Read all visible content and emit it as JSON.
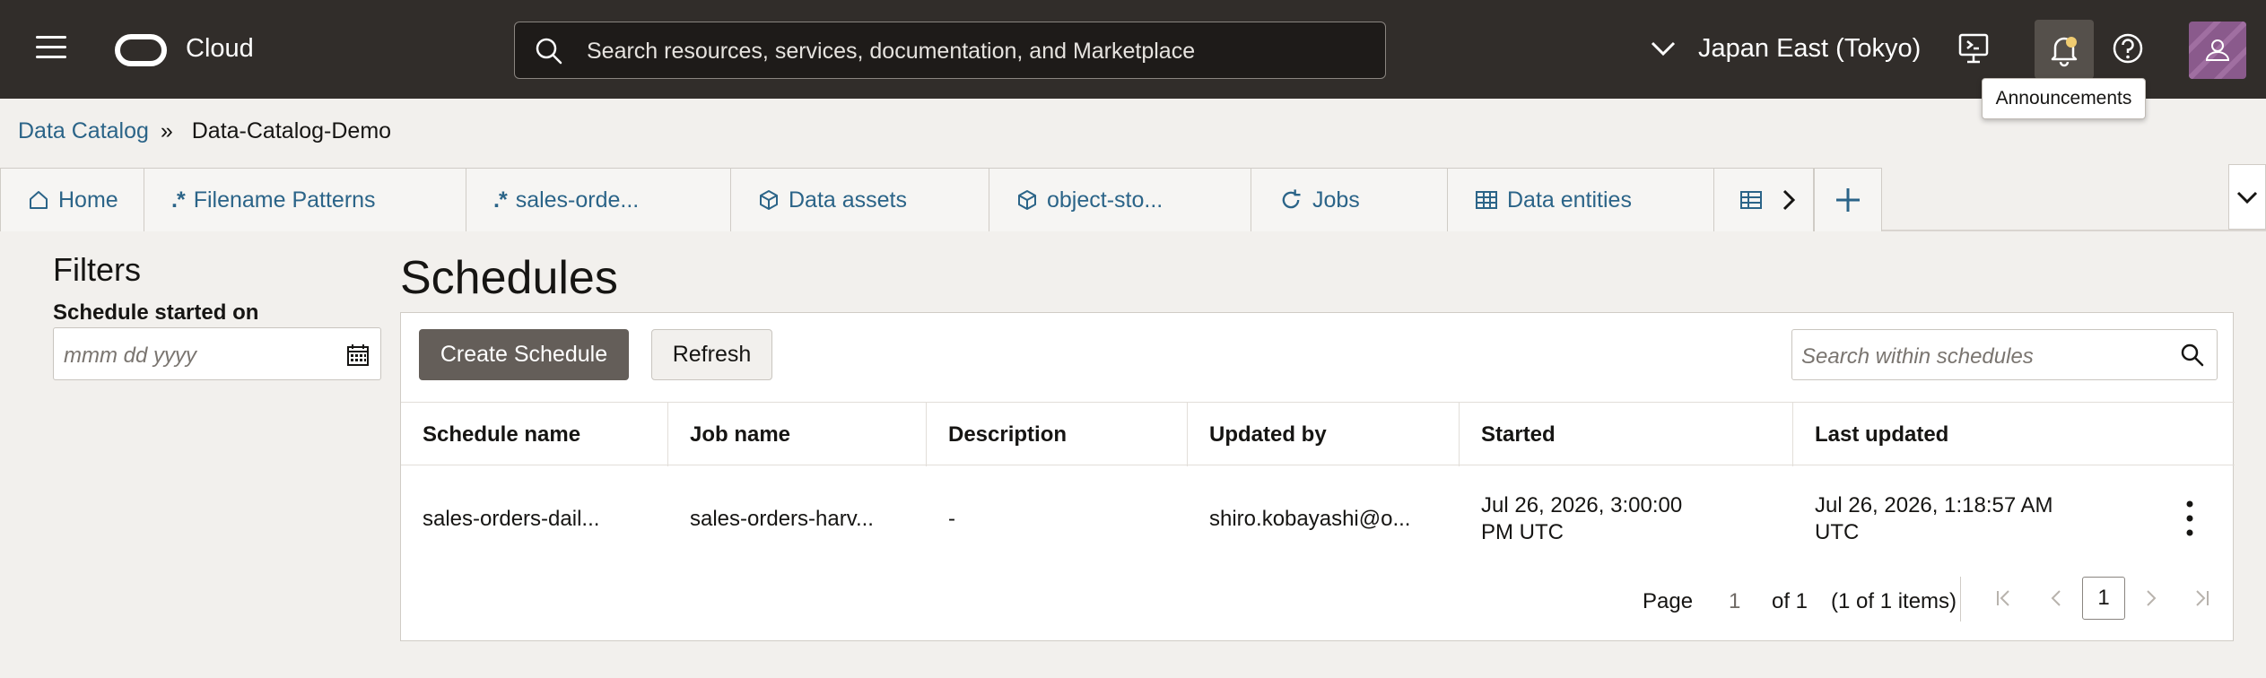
{
  "header": {
    "logo_text": "Cloud",
    "search_placeholder": "Search resources, services, documentation, and Marketplace",
    "region": "Japan East (Tokyo)",
    "tooltip": "Announcements"
  },
  "breadcrumb": {
    "root": "Data Catalog",
    "separator": "»",
    "current": "Data-Catalog-Demo"
  },
  "tabs": [
    {
      "label": "Home",
      "icon": "home-icon"
    },
    {
      "label": "Filename Patterns",
      "icon": "regex-icon"
    },
    {
      "label": "sales-orde...",
      "icon": "regex-icon"
    },
    {
      "label": "Data assets",
      "icon": "cube-icon"
    },
    {
      "label": "object-sto...",
      "icon": "cube-icon"
    },
    {
      "label": "Jobs",
      "icon": "refresh-icon"
    },
    {
      "label": "Data entities",
      "icon": "table-icon"
    }
  ],
  "filters": {
    "title": "Filters",
    "schedule_started_label": "Schedule started on",
    "date_placeholder": "mmm dd yyyy"
  },
  "main": {
    "title": "Schedules",
    "create_button": "Create Schedule",
    "refresh_button": "Refresh",
    "search_placeholder": "Search within schedules"
  },
  "table": {
    "columns": [
      "Schedule name",
      "Job name",
      "Description",
      "Updated by",
      "Started",
      "Last updated"
    ],
    "rows": [
      {
        "schedule_name": "sales-orders-dail...",
        "job_name": "sales-orders-harv...",
        "description": "-",
        "updated_by": "shiro.kobayashi@o...",
        "started": "Jul 26, 2026, 3:00:00 PM UTC",
        "last_updated": "Jul 26, 2026, 1:18:57 AM UTC"
      }
    ]
  },
  "pagination": {
    "page_label": "Page",
    "current_page": "1",
    "of_label": "of 1",
    "items_label": "(1 of 1 items)",
    "page_box": "1"
  }
}
